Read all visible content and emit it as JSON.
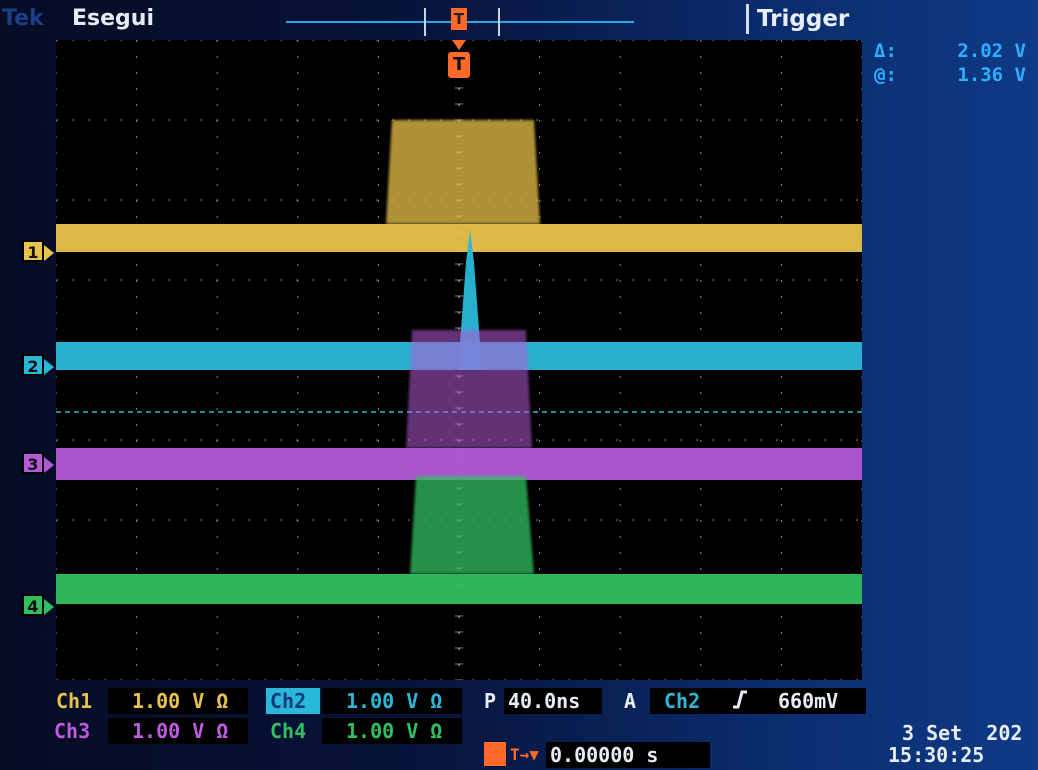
{
  "header": {
    "brand": "Tek",
    "run_status": "Esegui",
    "menu": "Trigger",
    "trigger_marker": "T"
  },
  "readout": {
    "delta_label": "Δ:",
    "delta_value": "2.02 V",
    "at_label": "@:",
    "at_value": "1.36 V"
  },
  "channels": {
    "ch1": {
      "marker": "1",
      "label": "Ch1",
      "scale": "1.00 V Ω",
      "color": "#e8c24a"
    },
    "ch2": {
      "marker": "2",
      "label": "Ch2",
      "scale": "1.00 V Ω",
      "color": "#2ab8d8"
    },
    "ch3": {
      "marker": "3",
      "label": "Ch3",
      "scale": "1.00 V Ω",
      "color": "#b45ad8"
    },
    "ch4": {
      "marker": "4",
      "label": "Ch4",
      "scale": "1.00 V Ω",
      "color": "#30c060"
    }
  },
  "horizontal": {
    "mode": "P",
    "scale": "40.0ns",
    "position_label": "T→▼",
    "position": "0.00000 s"
  },
  "trigger": {
    "mode": "A",
    "source": "Ch2",
    "slope_icon": "rising-edge-icon",
    "level": "660mV"
  },
  "timestamp": {
    "date": "3 Set  202",
    "time": "15:30:25"
  }
}
